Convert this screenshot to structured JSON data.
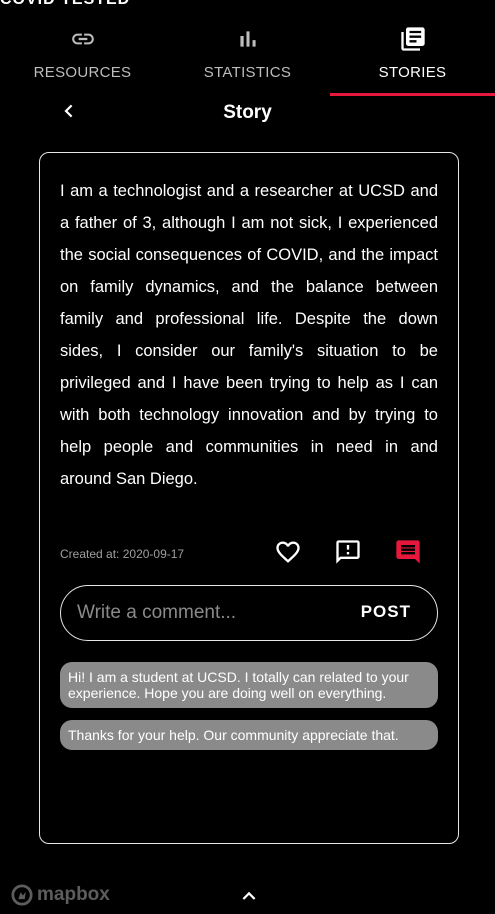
{
  "top_clip": {
    "text": "COVID TESTED"
  },
  "tabs": [
    {
      "label": "RESOURCES",
      "icon": "link-icon"
    },
    {
      "label": "STATISTICS",
      "icon": "bar-chart-icon"
    },
    {
      "label": "STORIES",
      "icon": "library-books-icon",
      "active": true
    }
  ],
  "header": {
    "title": "Story"
  },
  "story": {
    "text": "I am a technologist and a researcher at UCSD and a father of 3, although I am not sick, I experienced the social consequences of COVID, and the impact on family dynamics, and the balance between family and professional life. Despite the down sides, I consider our family's situation to be privileged and I have been trying to help as I can with both technology innovation and by trying to help people and communities in need in and around San Diego.",
    "created_label": "Created at:",
    "created_date": "2020-09-17"
  },
  "comment_form": {
    "placeholder": "Write a comment...",
    "post_label": "POST"
  },
  "comments": [
    {
      "text": "Hi! I am a student at UCSD. I totally can related to your experience. Hope you are doing well on everything."
    },
    {
      "text": "Thanks for your help. Our community appreciate that."
    }
  ],
  "footer": {
    "mapbox_label": "mapbox"
  },
  "colors": {
    "accent": "#e8183c",
    "background": "#000000",
    "bubble": "#8a8a8a"
  }
}
